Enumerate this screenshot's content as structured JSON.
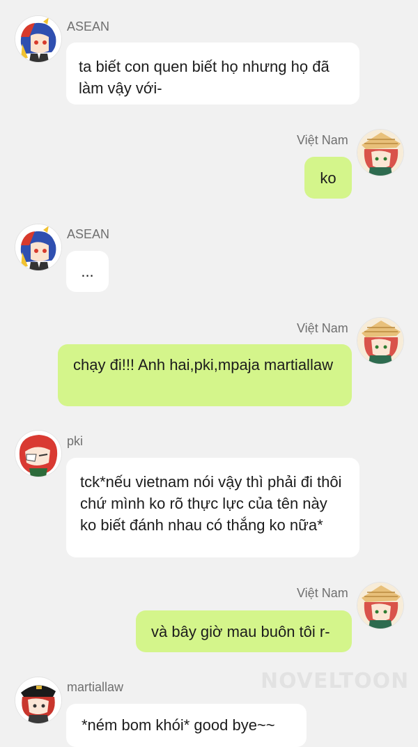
{
  "colors": {
    "background": "#f1f1f1",
    "received_bubble": "#ffffff",
    "sent_bubble": "#d4f58b",
    "name_text": "#6f6f6f",
    "message_text": "#1c1c1c"
  },
  "messages": [
    {
      "sender": "ASEAN",
      "side": "left",
      "avatar": "asean-avatar",
      "text": "ta biết con quen biết họ nhưng họ đã làm vậy với-"
    },
    {
      "sender": "Việt Nam",
      "side": "right",
      "avatar": "vietnam-avatar",
      "text": "ko"
    },
    {
      "sender": "ASEAN",
      "side": "left",
      "avatar": "asean-avatar",
      "text": "..."
    },
    {
      "sender": "Việt Nam",
      "side": "right",
      "avatar": "vietnam-avatar",
      "text": "chạy đi!!! Anh hai,pki,mpaja martiallaw"
    },
    {
      "sender": "pki",
      "side": "left",
      "avatar": "pki-avatar",
      "text": "tck*nếu vietnam nói vậy thì phải đi thôi chứ mình ko rõ thực lực của tên này ko biết đánh nhau có thắng ko nữa*"
    },
    {
      "sender": "Việt Nam",
      "side": "right",
      "avatar": "vietnam-avatar",
      "text": "và bây giờ mau buôn tôi r-"
    },
    {
      "sender": "martiallaw",
      "side": "left",
      "avatar": "martiallaw-avatar",
      "text": "*ném bom khói* good bye~~"
    }
  ],
  "watermark": "NOVELTOON"
}
